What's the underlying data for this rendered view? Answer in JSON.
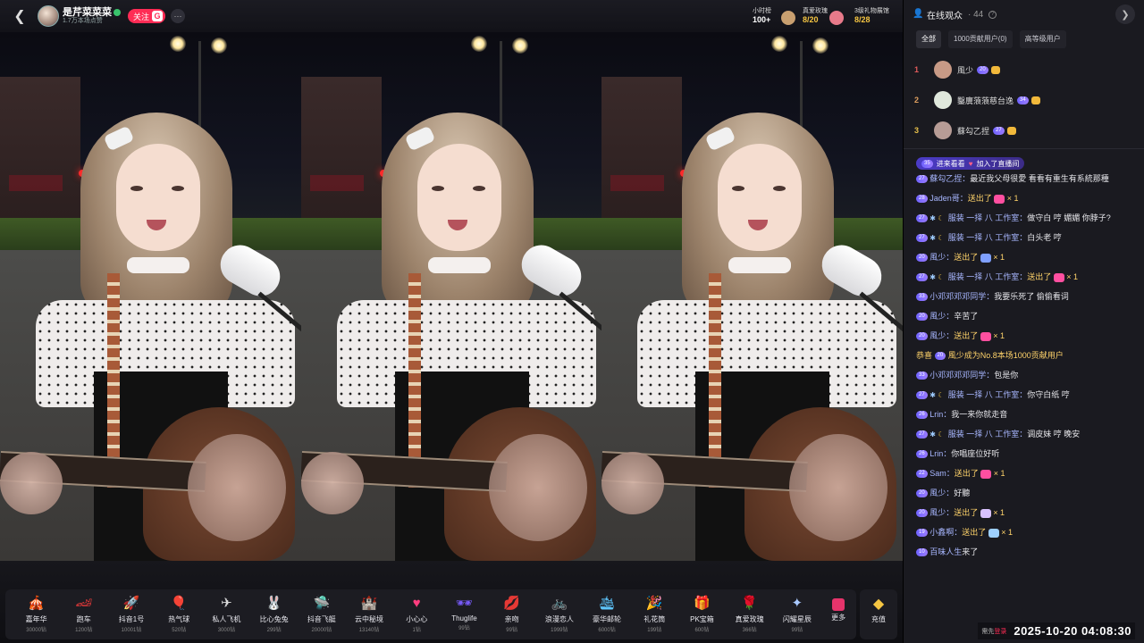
{
  "header": {
    "host_name": "是芹菜菜菜",
    "host_sub": "1.7万本场点赞",
    "follow_label": "关注",
    "follow_badge": "G",
    "more_label": "···"
  },
  "rank_boxes": [
    {
      "title": "小时榜",
      "value": "100+"
    },
    {
      "title": "真爱玫瑰",
      "value": "8/20"
    },
    {
      "title": "3级礼物展馆",
      "value": "8/28"
    }
  ],
  "gifts": [
    {
      "name": "嘉年华",
      "price": "30000钻",
      "icon": "carnival-icon",
      "emoji": "🎪",
      "color": "#f7c948"
    },
    {
      "name": "跑车",
      "price": "1200钻",
      "icon": "car-icon",
      "emoji": "🏎",
      "color": "#e93a3a"
    },
    {
      "name": "抖音1号",
      "price": "10001钻",
      "icon": "rocket-icon",
      "emoji": "🚀",
      "color": "#5b7cff"
    },
    {
      "name": "热气球",
      "price": "520钻",
      "icon": "balloon-icon",
      "emoji": "🎈",
      "color": "#ff7c9c"
    },
    {
      "name": "私人飞机",
      "price": "3000钻",
      "icon": "plane-icon",
      "emoji": "✈",
      "color": "#d9d9d9"
    },
    {
      "name": "比心兔兔",
      "price": "299钻",
      "icon": "rabbit-icon",
      "emoji": "🐰",
      "color": "#c9b6ff"
    },
    {
      "name": "抖音飞艇",
      "price": "20000钻",
      "icon": "airship-icon",
      "emoji": "🛸",
      "color": "#7a6bff"
    },
    {
      "name": "云中秘境",
      "price": "13140钻",
      "icon": "cloud-realm-icon",
      "emoji": "🏰",
      "color": "#9ec7ff"
    },
    {
      "name": "小心心",
      "price": "1钻",
      "icon": "heart-icon",
      "emoji": "♥",
      "color": "#ff3d7f"
    },
    {
      "name": "Thuglife",
      "price": "99钻",
      "icon": "sunglasses-icon",
      "emoji": "🕶",
      "color": "#7a5cff"
    },
    {
      "name": "亲吻",
      "price": "99钻",
      "icon": "kiss-icon",
      "emoji": "💋",
      "color": "#ff4fa0"
    },
    {
      "name": "浪漫恋人",
      "price": "1999钻",
      "icon": "bicycle-icon",
      "emoji": "🚲",
      "color": "#f0b060"
    },
    {
      "name": "豪华邮轮",
      "price": "6000钻",
      "icon": "cruise-icon",
      "emoji": "🛳",
      "color": "#5fc7ff"
    },
    {
      "name": "礼花筒",
      "price": "199钻",
      "icon": "confetti-icon",
      "emoji": "🎉",
      "color": "#b98aff"
    },
    {
      "name": "PK宝箱",
      "price": "600钻",
      "icon": "treasure-icon",
      "emoji": "🎁",
      "color": "#ff6aa8"
    },
    {
      "name": "真爱玫瑰",
      "price": "366钻",
      "icon": "rose-icon",
      "emoji": "🌹",
      "color": "#ff5a5a"
    },
    {
      "name": "闪耀星辰",
      "price": "99钻",
      "icon": "star-icon",
      "emoji": "✦",
      "color": "#a9c9ff"
    }
  ],
  "gift_more_label": "更多",
  "recharge_label": "充值",
  "audience": {
    "title": "在线观众",
    "count": "· 44",
    "tabs": [
      "全部",
      "1000贡献用户(0)",
      "高等级用户"
    ],
    "ranking": [
      {
        "rank": "1",
        "name": "風少",
        "level": "20",
        "color": "#e05a5a"
      },
      {
        "rank": "2",
        "name": "鑿廙蒗蒗慈台逸",
        "level": "34",
        "color": "#e0a060"
      },
      {
        "rank": "3",
        "name": "蘇勾乙捏",
        "level": "27",
        "color": "#e8c04a"
      }
    ]
  },
  "chat": {
    "enter_level": "35",
    "enter_text": "进来看看",
    "enter_action": "加入了直播间",
    "messages": [
      {
        "level": "27",
        "user": "蘇勾乙捏：",
        "text": "最近我父母很愛 看看有重生有系統那種"
      },
      {
        "level": "28",
        "user": "Jaden哥：",
        "gift": "送出了",
        "count": "× 1",
        "emColor": "#ff4fa0"
      },
      {
        "level": "27",
        "user": "服装 一择 八 工作室：",
        "text": "做守白 哼 媚媚 你脖子?"
      },
      {
        "level": "27",
        "user": "服装 一择 八 工作室：",
        "text": "白头老 哼"
      },
      {
        "level": "20",
        "user": "風少：",
        "gift": "送出了",
        "count": "× 1",
        "emColor": "#7fa0ff"
      },
      {
        "level": "27",
        "user": "服装 一择 八 工作室：",
        "gift": "送出了",
        "count": "× 1",
        "emColor": "#ff4fa0"
      },
      {
        "level": "33",
        "user": "小邓邓邓邓同学：",
        "text": "我要乐死了 偷偷看词"
      },
      {
        "level": "20",
        "user": "風少：",
        "text": "辛苦了"
      },
      {
        "level": "20",
        "user": "風少：",
        "gift": "送出了",
        "count": "× 1",
        "emColor": "#ff4fa0"
      },
      {
        "pre": "恭喜",
        "level": "20",
        "user": "",
        "text": "風少成为No.8本场1000贡献用户"
      },
      {
        "level": "33",
        "user": "小邓邓邓邓同学：",
        "text": "包是你"
      },
      {
        "level": "27",
        "user": "服装 一择 八 工作室：",
        "text": "你守白纸 哼"
      },
      {
        "level": "26",
        "user": "Lrin：",
        "text": "我一来你就走音"
      },
      {
        "level": "27",
        "user": "服装 一择 八 工作室：",
        "text": "调皮妹 哼 晚安"
      },
      {
        "level": "26",
        "user": "Lrin：",
        "text": "你唱座位好听"
      },
      {
        "level": "22",
        "user": "Sam：",
        "gift": "送出了",
        "count": "× 1",
        "emColor": "#ff4fa0"
      },
      {
        "level": "20",
        "user": "風少：",
        "text": "好聽"
      },
      {
        "level": "20",
        "user": "風少：",
        "gift": "送出了",
        "count": "× 1",
        "emColor": "#d9c2ff"
      },
      {
        "level": "19",
        "user": "小鑫啊：",
        "gift": "送出了",
        "count": "× 1",
        "emColor": "#9ed0ff"
      },
      {
        "level": "10",
        "user": "百味人生",
        "text": "来了"
      }
    ]
  },
  "footer": {
    "tip": "需先",
    "tip2": "登录",
    "datetime": "2025-10-20 04:08:30"
  }
}
